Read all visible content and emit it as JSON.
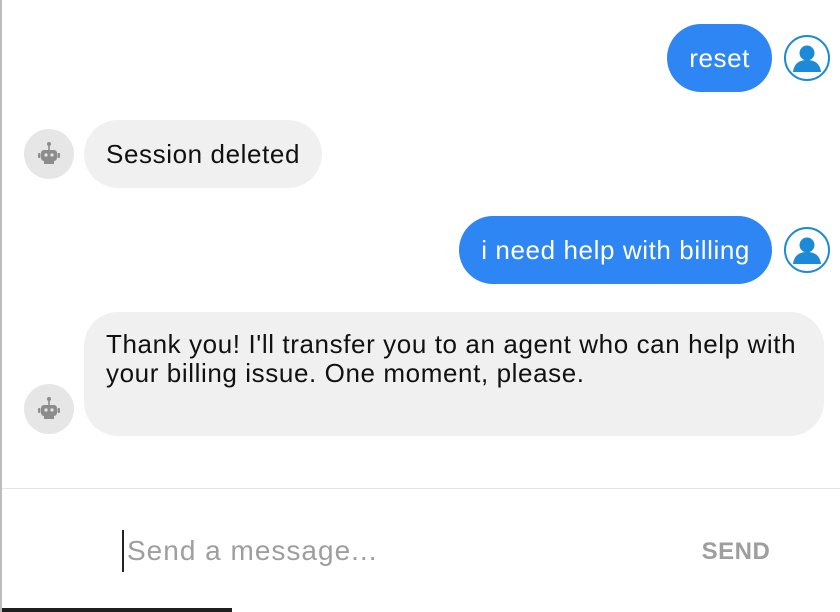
{
  "chat": {
    "messages": [
      {
        "sender": "user",
        "text": "reset",
        "avatar_icon": "user-icon"
      },
      {
        "sender": "bot",
        "text": "Session deleted",
        "avatar_icon": "robot-icon"
      },
      {
        "sender": "user",
        "text": "i need help with billing",
        "avatar_icon": "user-icon"
      },
      {
        "sender": "bot",
        "text": "Thank you! I'll transfer you to an agent who can help with your billing issue. One moment, please.",
        "avatar_icon": "robot-icon"
      }
    ]
  },
  "composer": {
    "placeholder": "Send a message...",
    "value": "",
    "send_label": "SEND"
  },
  "colors": {
    "user_bubble": "#2e86f5",
    "bot_bubble": "#f0f0f0",
    "user_avatar_accent": "#1c8ad6",
    "send_disabled": "#9e9e9e"
  }
}
